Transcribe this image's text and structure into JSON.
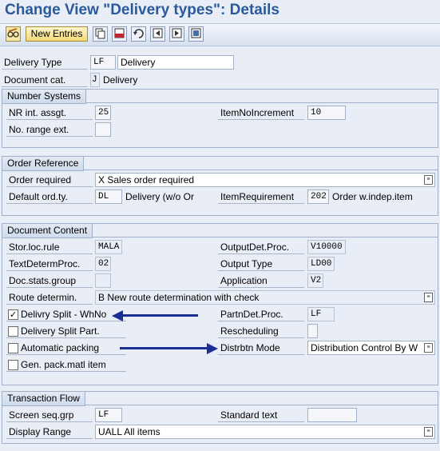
{
  "window": {
    "title": "Change View \"Delivery types\": Details"
  },
  "toolbar": {
    "new_entries_label": "New Entries",
    "icons": [
      "edit-glasses-icon",
      "copy-icon",
      "delete-icon",
      "undo-icon",
      "previous-entry-icon",
      "next-entry-icon",
      "select-all-icon"
    ]
  },
  "header": {
    "delivery_type_label": "Delivery Type",
    "delivery_type_code": "LF",
    "delivery_type_name": "Delivery",
    "doc_cat_label": "Document cat.",
    "doc_cat_code": "J",
    "doc_cat_name": "Delivery"
  },
  "number_systems": {
    "title": "Number Systems",
    "nr_int_label": "NR int. assgt.",
    "nr_int_value": "25",
    "item_no_incr_label": "ItemNoIncrement",
    "item_no_incr_value": "10",
    "nr_ext_label": "No. range ext.",
    "nr_ext_value": ""
  },
  "order_reference": {
    "title": "Order Reference",
    "order_required_label": "Order required",
    "order_required_value": "X Sales order required",
    "default_ord_label": "Default ord.ty.",
    "default_ord_value": "DL",
    "default_ord_text": "Delivery (w/o Or",
    "item_req_label": "ItemRequirement",
    "item_req_value": "202",
    "item_req_text": "Order w.indep.item"
  },
  "document_content": {
    "title": "Document Content",
    "stor_loc_label": "Stor.loc.rule",
    "stor_loc_value": "MALA",
    "output_det_label": "OutputDet.Proc.",
    "output_det_value": "V10000",
    "text_determ_label": "TextDetermProc.",
    "text_determ_value": "02",
    "output_type_label": "Output Type",
    "output_type_value": "LD00",
    "doc_stats_label": "Doc.stats.group",
    "doc_stats_value": "",
    "application_label": "Application",
    "application_value": "V2",
    "route_label": "Route determin.",
    "route_value": "B New route determination with check",
    "split_whno_label": "Delivry Split - WhNo",
    "split_whno_checked": true,
    "partn_det_label": "PartnDet.Proc.",
    "partn_det_value": "LF",
    "split_part_label": "Delivery Split Part.",
    "split_part_checked": false,
    "rescheduling_label": "Rescheduling",
    "rescheduling_value": "",
    "auto_packing_label": "Automatic packing",
    "auto_packing_checked": false,
    "distr_mode_label": "Distrbtn Mode",
    "distr_mode_value": "Distribution Control By W",
    "gen_pack_label": "Gen. pack.matl item",
    "gen_pack_checked": false
  },
  "transaction_flow": {
    "title": "Transaction Flow",
    "screen_seq_label": "Screen seq.grp",
    "screen_seq_value": "LF",
    "std_text_label": "Standard text",
    "std_text_value": "",
    "display_range_label": "Display Range",
    "display_range_value": "UALL All items"
  },
  "colors": {
    "title": "#2a5a9c",
    "background": "#e9eef6",
    "annotation_arrow": "#1b2e95"
  }
}
